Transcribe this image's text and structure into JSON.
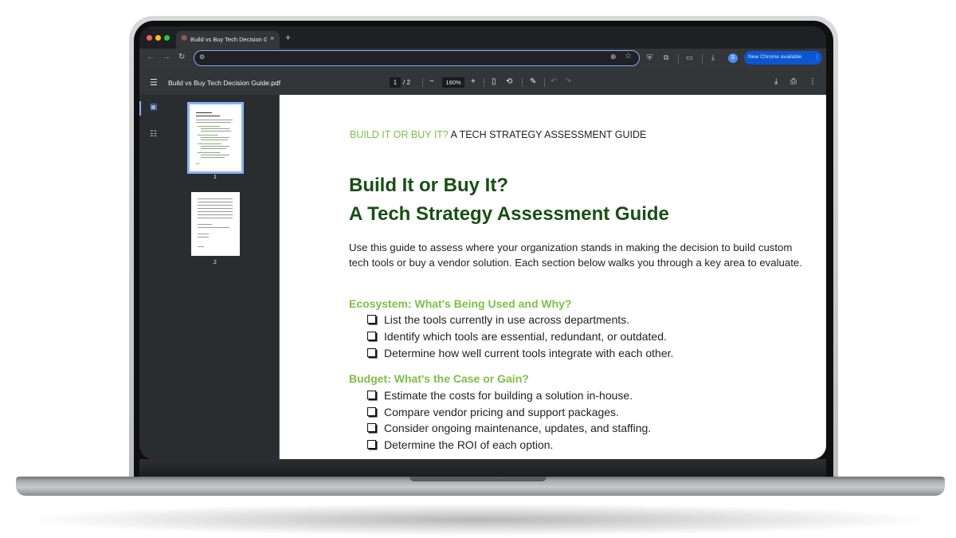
{
  "browser": {
    "tab_title": "Build vs Buy Tech Decision G",
    "tab_close": "×",
    "new_tab": "+",
    "update_button": "New Chrome available",
    "update_menu": "⋮"
  },
  "pdf_toolbar": {
    "filename": "Build vs Buy Tech Decision Guide.pdf",
    "current_page": "1",
    "page_total": "/ 2",
    "zoom": "160%",
    "zoom_out": "−",
    "zoom_in": "+"
  },
  "sidebar": {
    "thumbnails": [
      {
        "label": "1"
      },
      {
        "label": "2"
      }
    ]
  },
  "document": {
    "running_head_green": "BUILD IT OR BUY IT?",
    "running_head_rest": " A TECH STRATEGY ASSESSMENT GUIDE",
    "title_line1": "Build It or Buy It?",
    "title_line2": "A Tech Strategy Assessment Guide",
    "intro": "Use this guide to assess where your organization stands in making the decision to build custom tech tools or buy a vendor solution. Each section below walks you through a key area to evaluate.",
    "sections": [
      {
        "heading": "Ecosystem: What's Being Used and Why?",
        "items": [
          "List the tools currently in use across departments.",
          "Identify which tools are essential, redundant, or outdated.",
          "Determine how well current tools integrate with each other."
        ]
      },
      {
        "heading": "Budget: What's the Case or Gain?",
        "items": [
          "Estimate the costs for building a solution in-house.",
          "Compare vendor pricing and support packages.",
          "Consider ongoing maintenance, updates, and staffing.",
          "Determine the ROI of each option."
        ]
      }
    ]
  },
  "colors": {
    "accent_green": "#7cbf45",
    "title_green": "#184e14",
    "chrome_blue": "#0b57d0"
  }
}
